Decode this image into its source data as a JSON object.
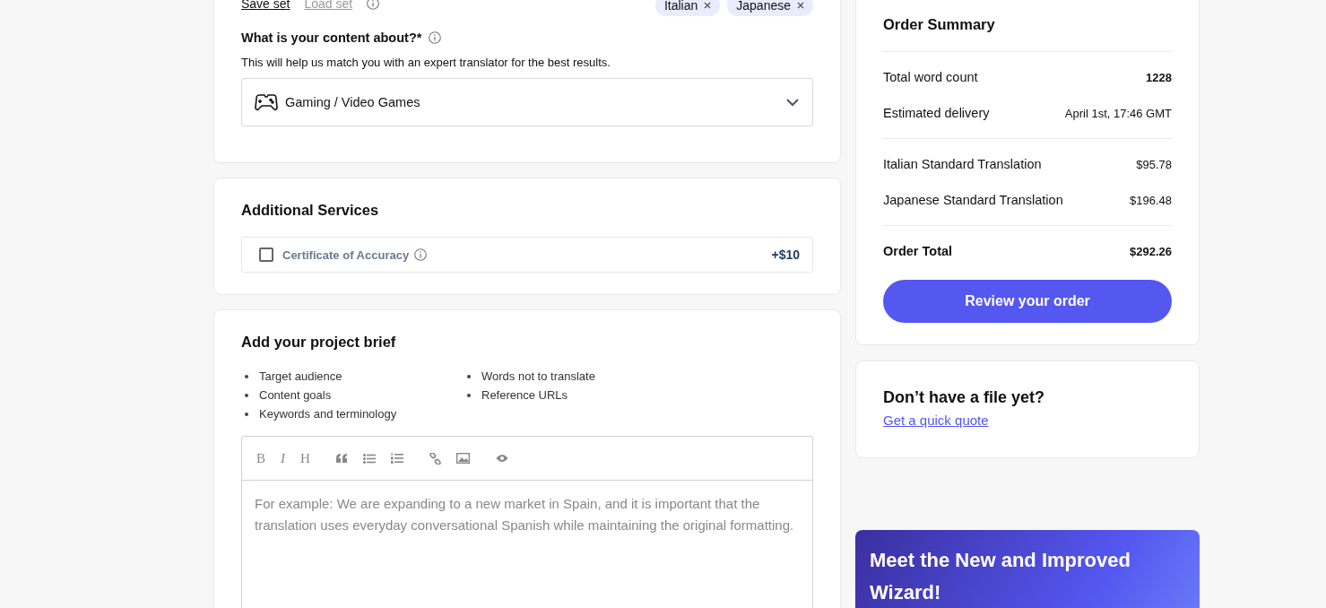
{
  "language_set": {
    "links": [
      {
        "label": "Save set",
        "disabled": false
      },
      {
        "label": "Load set",
        "disabled": true
      }
    ],
    "languages": [
      {
        "label": "Italian"
      },
      {
        "label": "Japanese"
      }
    ]
  },
  "content_topic": {
    "label": "What is your content about?*",
    "hint": "This will help us match you with an expert translator for the best results.",
    "value": "Gaming / Video Games"
  },
  "additional_services": {
    "title": "Additional Services",
    "items": [
      {
        "label": "Certificate of Accuracy",
        "checked": false,
        "price": "+$10"
      }
    ]
  },
  "project_brief": {
    "title": "Add your project brief",
    "tips_left": [
      "Target audience",
      "Content goals",
      "Keywords and terminology"
    ],
    "tips_right": [
      "Words not to translate",
      "Reference URLs"
    ],
    "toolbar": [
      "B",
      "I",
      "H"
    ],
    "placeholder": "For example: We are expanding to a new market in Spain, and it is important that the translation uses everyday conversational Spanish while maintaining the original formatting."
  },
  "order_summary": {
    "title": "Order Summary",
    "groups": [
      {
        "rows": [
          {
            "label": "Total word count",
            "value": "1228",
            "kind": "count"
          },
          {
            "label": "Estimated delivery",
            "value": "April 1st, 17:46 GMT",
            "kind": "plain"
          }
        ]
      },
      {
        "rows": [
          {
            "label": "Italian Standard Translation",
            "value": "$95.78",
            "kind": "plain"
          },
          {
            "label": "Japanese Standard Translation",
            "value": "$196.48",
            "kind": "plain"
          }
        ]
      },
      {
        "rows": [
          {
            "label": "Order Total",
            "value": "$292.26",
            "kind": "total"
          }
        ]
      }
    ],
    "button": "Review your order"
  },
  "quote_card": {
    "title": "Don’t have a file yet?",
    "link": "Get a quick quote"
  },
  "promo": {
    "title": "Meet the New and Improved Wizard!"
  }
}
